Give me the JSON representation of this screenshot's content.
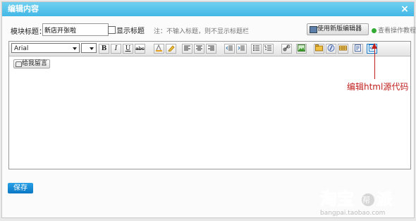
{
  "dialog": {
    "title": "编辑内容",
    "close_label": "×"
  },
  "form": {
    "module_title_label": "模块标题：",
    "module_title_value": "新店开张啦",
    "show_title_label": "显示标题",
    "hint": "注：不输入标题，则不显示标题栏",
    "new_editor_label": "使用新版编辑器",
    "help_label": "查看操作教程"
  },
  "toolbar": {
    "font_value": "Arial",
    "size_value": "",
    "buttons": {
      "bold": "B",
      "italic": "I",
      "underline": "U",
      "strike": "abc"
    }
  },
  "content": {
    "leave_message_button": "给我留言"
  },
  "annotation": {
    "text": "编辑html源代码",
    "color": "#c0211f"
  },
  "footer": {
    "save_label": "保存"
  },
  "watermark": {
    "brand": "淘宝帮派",
    "url": "bangpai.taobao.com"
  }
}
